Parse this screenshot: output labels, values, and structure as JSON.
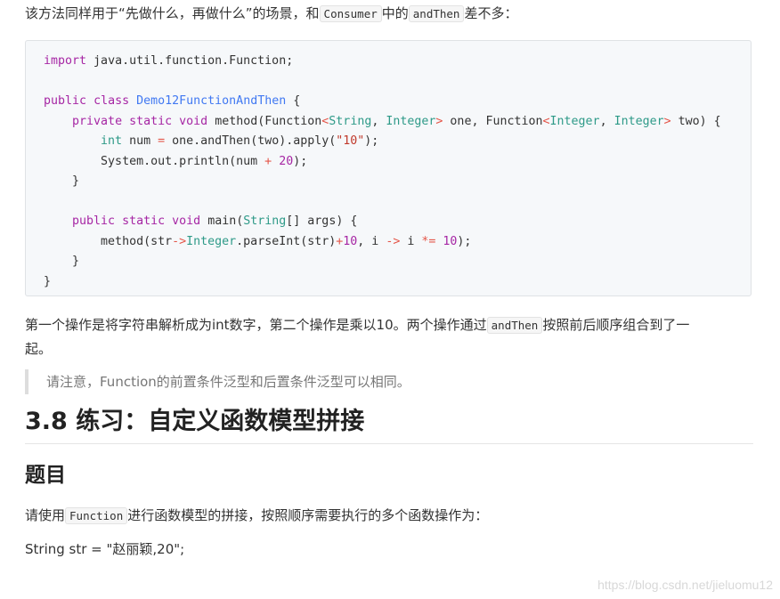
{
  "intro": {
    "before": "该方法同样用于“先做什么，再做什么”的场景，和",
    "code1": "Consumer",
    "middle": "中的",
    "code2": "andThen",
    "after": "差不多："
  },
  "code": {
    "line1": {
      "kw": "import",
      "rest": " java.util.function.Function;"
    },
    "line3": {
      "kw1": "public",
      "kw2": "class",
      "name": "Demo12FunctionAndThen",
      "rest": " {"
    },
    "line4": {
      "kw1": "private",
      "kw2": "static",
      "kw3": "void",
      "p1": " method(Function",
      "lt1": "<",
      "t1": "String",
      "c1": ", ",
      "t2": "Integer",
      "gt1": ">",
      "p2": " one, Function",
      "lt2": "<",
      "t3": "Integer",
      "c2": ", ",
      "t4": "Integer",
      "gt2": ">",
      "p3": " two) {"
    },
    "line5": {
      "ty": "int",
      "p1": " num ",
      "eq": "=",
      "p2": " one.andThen(two).apply(",
      "str": "\"10\"",
      "p3": ");"
    },
    "line6": {
      "p1": "System.out.println(num ",
      "plus": "+",
      "sp": " ",
      "num": "20",
      "p2": ");"
    },
    "line7": "}",
    "line9": {
      "kw1": "public",
      "kw2": "static",
      "kw3": "void",
      "p1": " main(",
      "ty": "String",
      "p2": "[] args) {"
    },
    "line10": {
      "p1": "method(str",
      "arrow1": "->",
      "ty": "Integer",
      "p2": ".parseInt(str)",
      "plus": "+",
      "num1": "10",
      "p3": ", i ",
      "arrow2": "->",
      "p4": " i ",
      "op": "*=",
      "sp": " ",
      "num2": "10",
      "p5": ");"
    },
    "line11": "}",
    "line12": "}"
  },
  "para2": {
    "before": "第一个操作是将字符串解析成为int数字，第二个操作是乘以10。两个操作通过",
    "code": "andThen",
    "after": "按照前后顺序组合到了一",
    "line2": "起。"
  },
  "quote": "请注意，Function的前置条件泛型和后置条件泛型可以相同。",
  "heading2": "3.8 练习：自定义函数模型拼接",
  "heading3": "题目",
  "para3": {
    "before": "请使用",
    "code": "Function",
    "after": "进行函数模型的拼接，按照顺序需要执行的多个函数操作为："
  },
  "para4": "String str = \"赵丽颖,20\";",
  "watermark": "https://blog.csdn.net/jieluomu12"
}
